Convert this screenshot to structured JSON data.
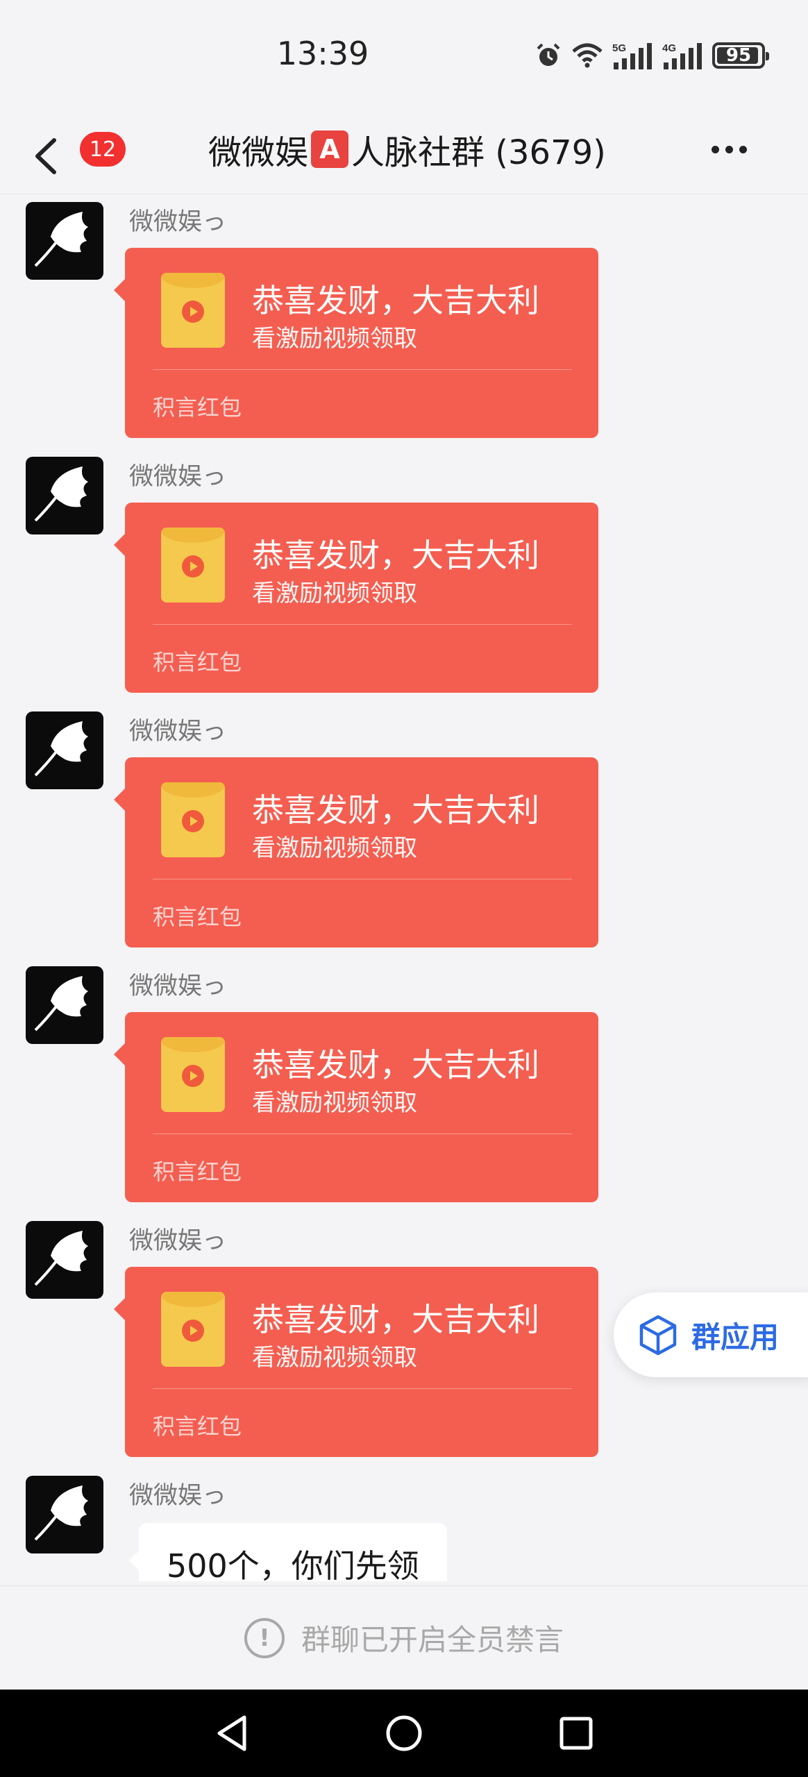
{
  "status_bar": {
    "time": "13:39",
    "battery": "95",
    "battery_level": 0.95,
    "network_labels": [
      "5G",
      "4G"
    ]
  },
  "header": {
    "back_icon": "chevron-left-icon",
    "unread_count": "12",
    "title_prefix": "微微娱",
    "title_badge": "A",
    "title_suffix": "人脉社群 (3679)",
    "more_icon": "more-horizontal-icon"
  },
  "messages": [
    {
      "sender": "微微娱っ",
      "type": "red_packet",
      "title": "恭喜发财，大吉大利",
      "subtitle": "看激励视频领取",
      "footer": "积言红包"
    },
    {
      "sender": "微微娱っ",
      "type": "red_packet",
      "title": "恭喜发财，大吉大利",
      "subtitle": "看激励视频领取",
      "footer": "积言红包"
    },
    {
      "sender": "微微娱っ",
      "type": "red_packet",
      "title": "恭喜发财，大吉大利",
      "subtitle": "看激励视频领取",
      "footer": "积言红包"
    },
    {
      "sender": "微微娱っ",
      "type": "red_packet",
      "title": "恭喜发财，大吉大利",
      "subtitle": "看激励视频领取",
      "footer": "积言红包"
    },
    {
      "sender": "微微娱っ",
      "type": "red_packet",
      "title": "恭喜发财，大吉大利",
      "subtitle": "看激励视频领取",
      "footer": "积言红包"
    },
    {
      "sender": "微微娱っ",
      "type": "text",
      "text": "500个，你们先领"
    }
  ],
  "group_app": {
    "label": "群应用",
    "icon": "cube-icon"
  },
  "muted_notice": {
    "text": "群聊已开启全员禁言",
    "icon": "exclamation-circle-icon"
  },
  "colors": {
    "red_packet": "#f45e50",
    "unread_badge": "#f23030",
    "accent_blue": "#2d6be4",
    "background": "#f4f4f6"
  }
}
